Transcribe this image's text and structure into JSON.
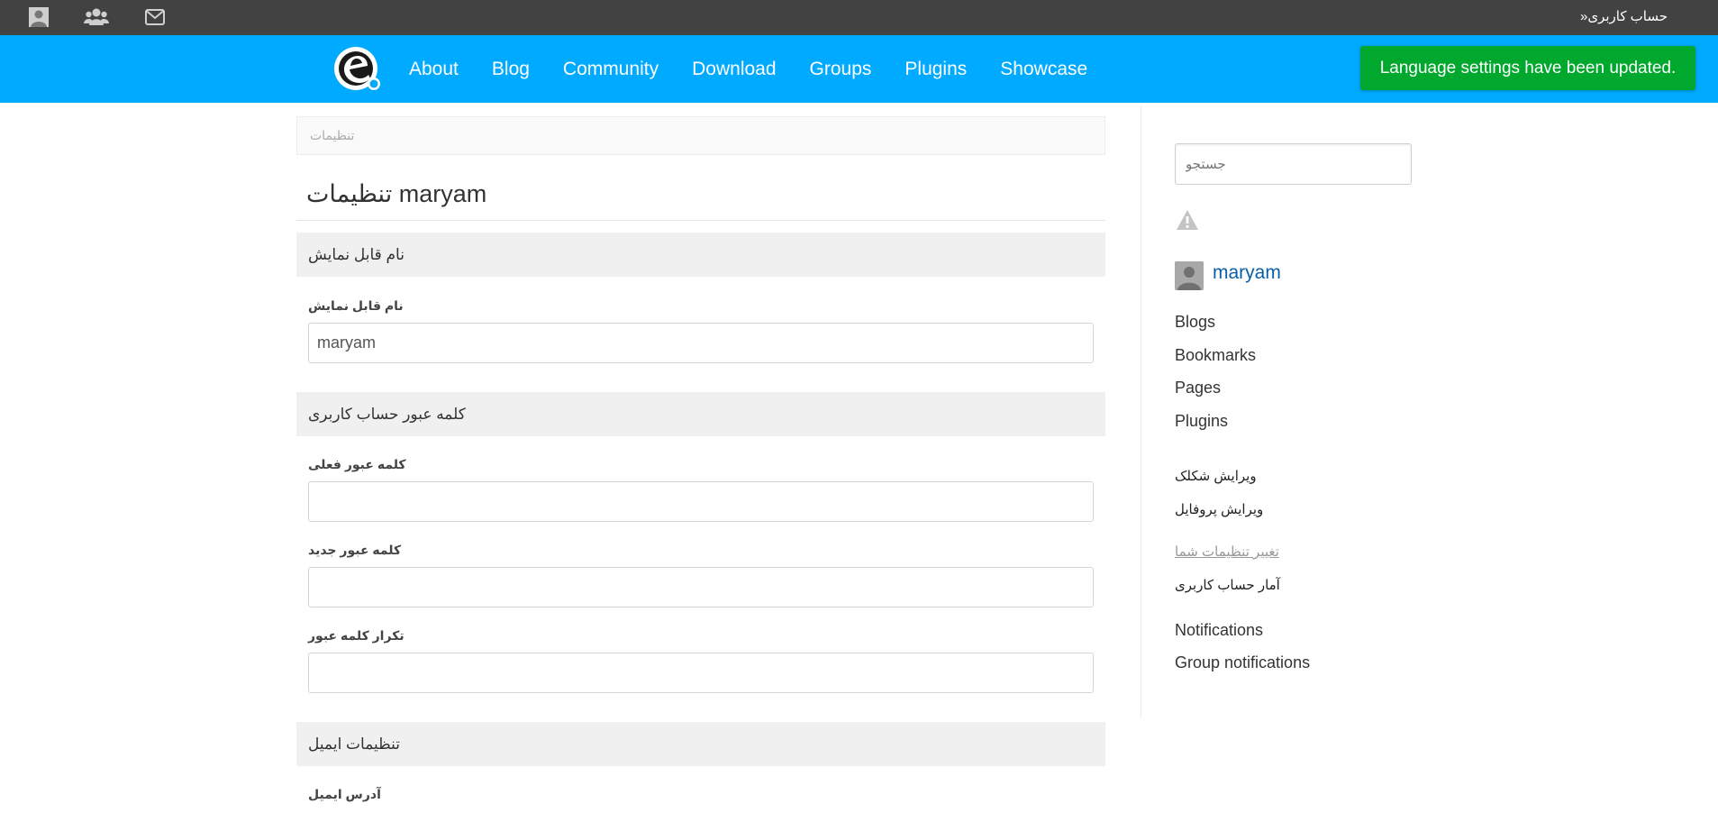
{
  "topbar": {
    "account_label": "حساب کاربری",
    "account_prefix": "«",
    "icons": [
      "avatar-icon",
      "friends-icon",
      "messages-icon"
    ]
  },
  "header": {
    "nav": [
      "About",
      "Blog",
      "Community",
      "Download",
      "Groups",
      "Plugins",
      "Showcase"
    ],
    "brand_color": "#00aaff"
  },
  "toast": {
    "message": "Language settings have been updated.",
    "color": "#00a82d"
  },
  "breadcrumb": "تنظیمات",
  "page_title": "تنظیمات maryam",
  "sections": {
    "display_name": {
      "heading": "نام قابل نمایش",
      "label": "نام قابل نمایش",
      "value": "maryam"
    },
    "password": {
      "heading": "کلمه عبور حساب کاربری",
      "current_label": "کلمه عبور فعلی",
      "current_value": "",
      "new_label": "کلمه عبور جدید",
      "new_value": "",
      "repeat_label": "تکرار کلمه عبور",
      "repeat_value": ""
    },
    "email": {
      "heading": "تنظیمات ایمیل",
      "address_label": "آدرس ایمیل"
    }
  },
  "sidebar": {
    "search_placeholder": "جستجو",
    "user_name": "maryam",
    "links": [
      "Blogs",
      "Bookmarks",
      "Pages",
      "Plugins"
    ],
    "profile_links": [
      "ویرایش شکلک",
      "ویرایش پروفایل"
    ],
    "settings_links": [
      "تغییر تنظیمات شما",
      "آمار حساب کاربری"
    ],
    "notification_links": [
      "Notifications",
      "Group notifications"
    ]
  }
}
